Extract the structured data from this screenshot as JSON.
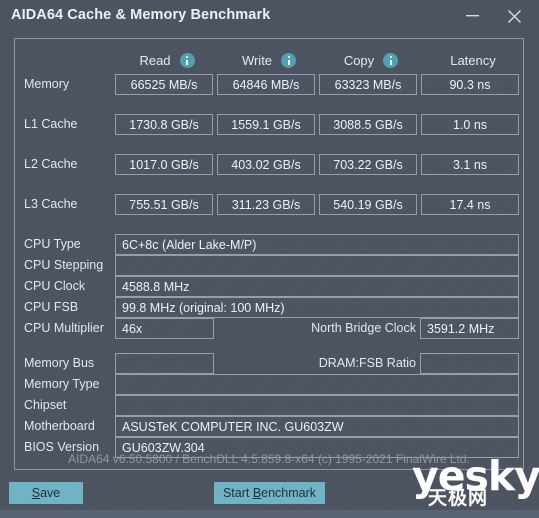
{
  "window": {
    "title": "AIDA64 Cache & Memory Benchmark",
    "minimize_label": "minimize",
    "close_label": "close"
  },
  "benchmark_table": {
    "columns": [
      {
        "label": "Read",
        "has_info": true
      },
      {
        "label": "Write",
        "has_info": true
      },
      {
        "label": "Copy",
        "has_info": true
      },
      {
        "label": "Latency",
        "has_info": false
      }
    ],
    "rows": [
      {
        "label": "Memory",
        "read": "66525 MB/s",
        "write": "64846 MB/s",
        "copy": "63323 MB/s",
        "latency": "90.3 ns"
      },
      {
        "label": "L1 Cache",
        "read": "1730.8 GB/s",
        "write": "1559.1 GB/s",
        "copy": "3088.5 GB/s",
        "latency": "1.0 ns"
      },
      {
        "label": "L2 Cache",
        "read": "1017.0 GB/s",
        "write": "403.02 GB/s",
        "copy": "703.22 GB/s",
        "latency": "3.1 ns"
      },
      {
        "label": "L3 Cache",
        "read": "755.51 GB/s",
        "write": "311.23 GB/s",
        "copy": "540.19 GB/s",
        "latency": "17.4 ns"
      }
    ]
  },
  "cpu_info": {
    "cpu_type_label": "CPU Type",
    "cpu_type_value": "6C+8c   (Alder Lake-M/P)",
    "cpu_stepping_label": "CPU Stepping",
    "cpu_stepping_value": "",
    "cpu_clock_label": "CPU Clock",
    "cpu_clock_value": "4588.8 MHz",
    "cpu_fsb_label": "CPU FSB",
    "cpu_fsb_value": "99.8 MHz  (original: 100 MHz)",
    "cpu_multiplier_label": "CPU Multiplier",
    "cpu_multiplier_value": "46x",
    "north_bridge_clock_label": "North Bridge Clock",
    "north_bridge_clock_value": "3591.2 MHz"
  },
  "memory_info": {
    "memory_bus_label": "Memory Bus",
    "memory_bus_value": "",
    "dram_fsb_ratio_label": "DRAM:FSB Ratio",
    "dram_fsb_ratio_value": "",
    "memory_type_label": "Memory Type",
    "memory_type_value": "",
    "chipset_label": "Chipset",
    "chipset_value": "",
    "motherboard_label": "Motherboard",
    "motherboard_value": "ASUSTeK COMPUTER INC. GU603ZW",
    "bios_version_label": "BIOS Version",
    "bios_version_value": "GU603ZW.304"
  },
  "footer": {
    "version_text": "AIDA64 v6.50.5800 / BenchDLL 4.5.859.8-x64  (c) 1995-2021 FinalWire Ltd.",
    "save_button": "Save",
    "save_accel": "S",
    "save_rest": "ave",
    "start_button": "Start Benchmark",
    "start_prefix": "Start ",
    "start_accel": "B",
    "start_rest": "enchmark"
  },
  "watermark": {
    "latin": "yesky",
    "cjk": "天极网"
  },
  "colors": {
    "window_bg": "#4c5361",
    "accent_teal": "#6fb3c4",
    "info_icon": "#53a0b2",
    "field_border": "#959fa9",
    "panel_border": "#8e98a4",
    "text_primary": "#e6eaee",
    "text_muted": "#8d99a6"
  }
}
